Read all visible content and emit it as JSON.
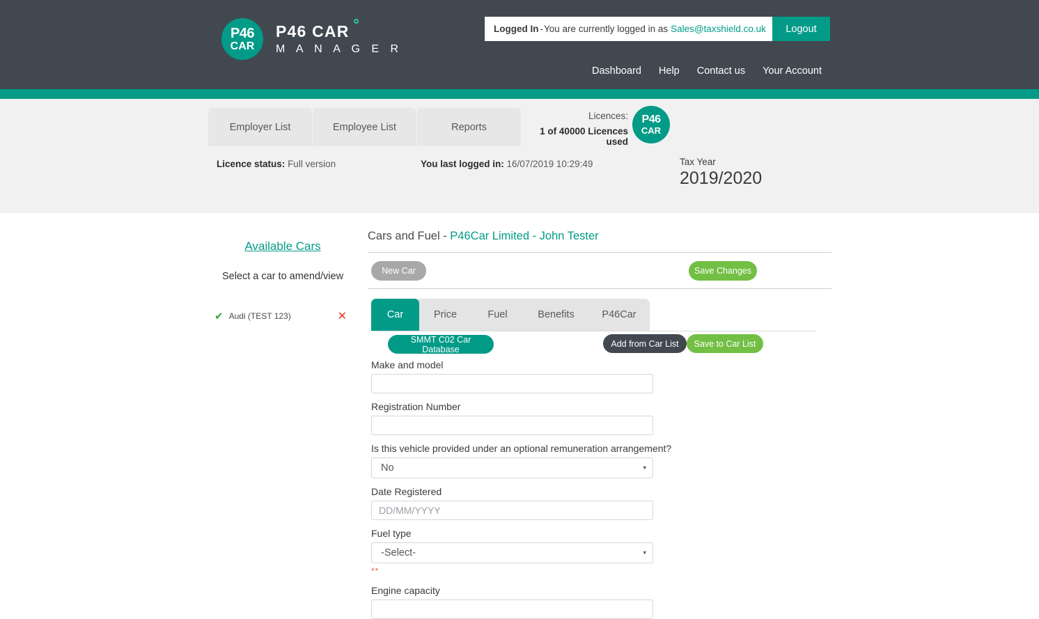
{
  "header": {
    "logo": {
      "line1": "P46",
      "line2": "CAR"
    },
    "brand_line1": "P46 CAR",
    "brand_line2": "M A N A G E R",
    "login": {
      "status_label": "Logged In",
      "dash": "-",
      "message": "You are currently logged in as",
      "email": "Sales@taxshield.co.uk",
      "logout_label": "Logout"
    },
    "nav": [
      {
        "label": "Dashboard"
      },
      {
        "label": "Help"
      },
      {
        "label": "Contact us"
      },
      {
        "label": "Your Account"
      }
    ],
    "accent_color": "#029b88",
    "bar_color": "#414850"
  },
  "subheader": {
    "tabs": [
      {
        "label": "Employer List"
      },
      {
        "label": "Employee List"
      },
      {
        "label": "Reports"
      }
    ],
    "licences": {
      "label": "Licences:",
      "value": "1 of 40000 Licences used",
      "badge_line1": "P46",
      "badge_line2": "CAR"
    },
    "licence_status_label": "Licence status:",
    "licence_status_value": "Full version",
    "last_login_label": "You last logged in:",
    "last_login_value": "16/07/2019 10:29:49",
    "tax_year_label": "Tax Year",
    "tax_year_value": "2019/2020"
  },
  "sidebar": {
    "heading": "Available Cars",
    "hint": "Select a car to amend/view",
    "cars": [
      {
        "name": "Audi (TEST 123)",
        "tick": "✔",
        "delete": "✕"
      }
    ]
  },
  "content": {
    "title_main": "Cars and Fuel - ",
    "title_sub": "P46Car Limited - John Tester",
    "new_car_label": "New Car",
    "save_changes_label": "Save Changes",
    "tabs": [
      {
        "label": "Car",
        "active": true
      },
      {
        "label": "Price",
        "active": false
      },
      {
        "label": "Fuel",
        "active": false
      },
      {
        "label": "Benefits",
        "active": false
      },
      {
        "label": "P46Car",
        "active": false
      }
    ],
    "buttons": {
      "smmt_label": "SMMT C02 Car Database",
      "add_from_car_list_label": "Add from Car List",
      "save_to_car_list_label": "Save to Car List"
    },
    "form": {
      "make_and_model": {
        "label": "Make and model",
        "value": "",
        "placeholder": ""
      },
      "registration_number": {
        "label": "Registration Number",
        "value": "",
        "placeholder": ""
      },
      "optional_remuneration": {
        "label": "Is this vehicle provided under an optional remuneration arrangement?",
        "value": "No",
        "caret": "▾"
      },
      "date_registered": {
        "label": "Date Registered",
        "value": "",
        "placeholder": "DD/MM/YYYY"
      },
      "fuel_type": {
        "label": "Fuel type",
        "value": "-Select-",
        "caret": "▾",
        "required_marker": "**"
      },
      "engine_capacity": {
        "label": "Engine capacity",
        "value": "",
        "placeholder": ""
      }
    }
  }
}
